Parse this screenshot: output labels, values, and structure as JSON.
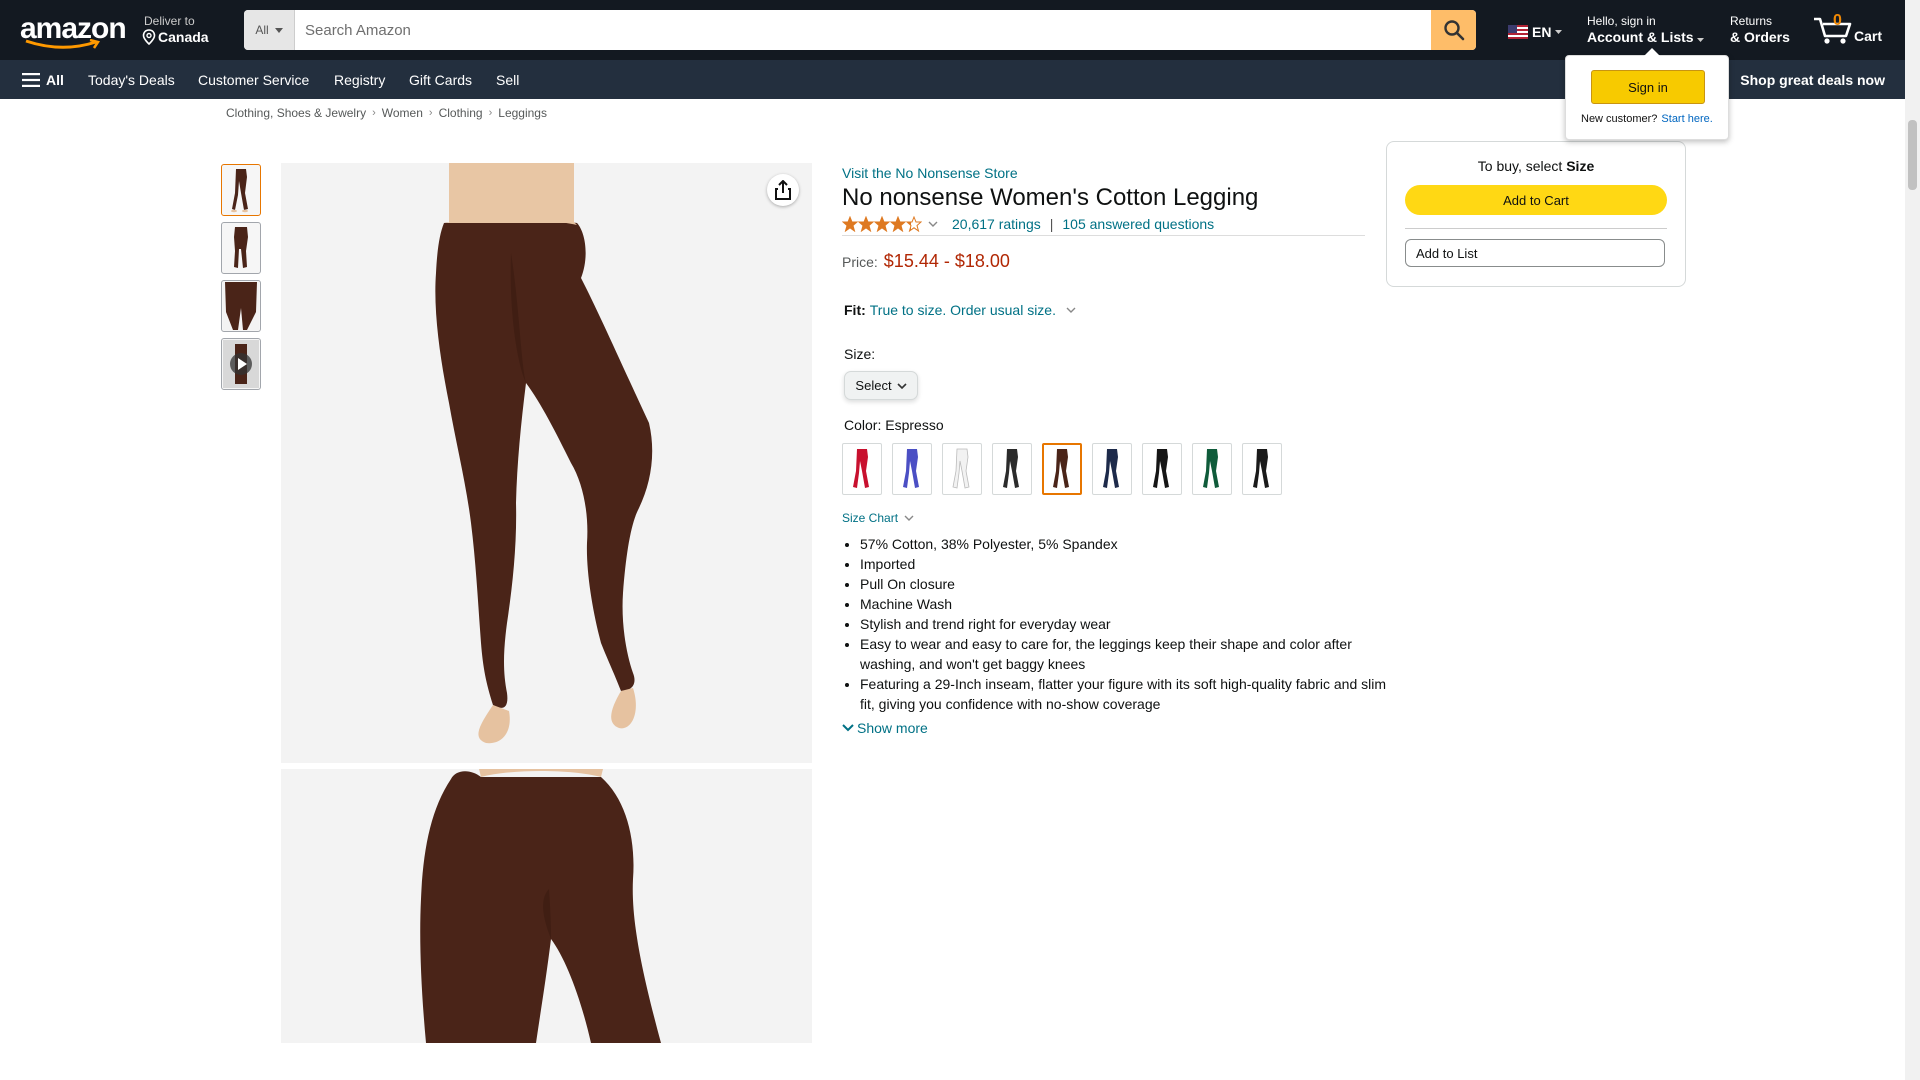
{
  "header": {
    "logo_text": "amazon",
    "deliver_to": "Deliver to",
    "location": "Canada",
    "search_category": "All",
    "search_placeholder": "Search Amazon",
    "lang": "EN",
    "account_greeting": "Hello, sign in",
    "account_label": "Account & Lists",
    "returns_small": "Returns",
    "returns_big": "& Orders",
    "cart_count": "0",
    "cart_label": "Cart"
  },
  "nav": {
    "all": "All",
    "items": [
      "Today's Deals",
      "Customer Service",
      "Registry",
      "Gift Cards",
      "Sell"
    ],
    "promo": "Shop great deals now"
  },
  "signin_popover": {
    "button": "Sign in",
    "new_customer": "New customer?",
    "start_here": "Start here."
  },
  "breadcrumb": [
    "Clothing, Shoes & Jewelry",
    "Women",
    "Clothing",
    "Leggings"
  ],
  "product": {
    "store_link": "Visit the No Nonsense Store",
    "title": "No nonsense Women's Cotton Legging",
    "rating_stars": 4.3,
    "ratings_count": "20,617 ratings",
    "answered_questions": "105 answered questions",
    "price_label": "Price:",
    "price": "$15.44 - $18.00",
    "fit_label": "Fit:",
    "fit_value": "True to size. Order usual size.",
    "size_label": "Size:",
    "size_select": "Select",
    "color_label": "Color:",
    "color_value": "Espresso",
    "swatch_colors": [
      "#c8102e",
      "#4b4fc4",
      "#f2f2f2",
      "#2b2b2b",
      "#4a2418",
      "#1d2a4a",
      "#151515",
      "#0f5b3a",
      "#1a1a1a"
    ],
    "selected_swatch": 4,
    "size_chart": "Size Chart",
    "bullets": [
      "57% Cotton, 38% Polyester, 5% Spandex",
      "Imported",
      "Pull On closure",
      "Machine Wash",
      "Stylish and trend right for everyday wear",
      "Easy to wear and easy to care for, the leggings keep their shape and color after washing, and won't get baggy knees",
      "Featuring a 29-Inch inseam, flatter your figure with its soft high-quality fabric and slim fit, giving you confidence with no-show coverage"
    ],
    "show_more": "Show more"
  },
  "buybox": {
    "to_buy_prefix": "To buy, select ",
    "to_buy_bold": "Size",
    "add_to_cart": "Add to Cart",
    "add_to_list": "Add to List"
  },
  "colors": {
    "header_bg": "#131921",
    "nav_bg": "#232f3e",
    "link": "#007185",
    "price": "#b12704",
    "cart_button": "#ffd814",
    "search_button": "#febd69",
    "legging": "#4a2418"
  }
}
